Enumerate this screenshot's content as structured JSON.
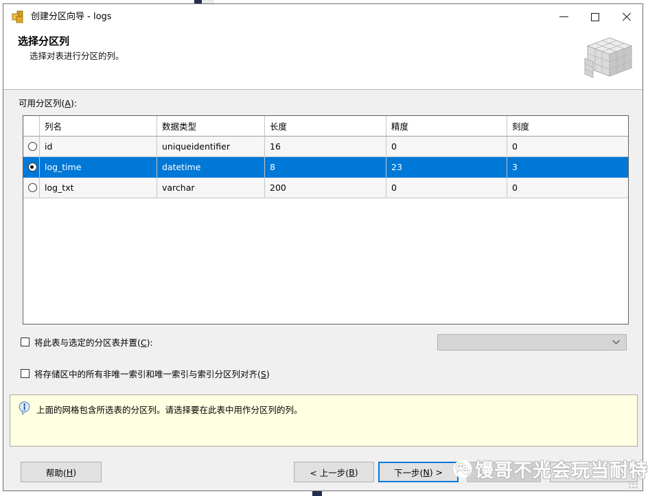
{
  "window": {
    "title": "创建分区向导 - logs",
    "controls": {
      "minimize": "—",
      "maximize": "□",
      "close": "×"
    }
  },
  "header": {
    "title": "选择分区列",
    "subtitle": "选择对表进行分区的列。"
  },
  "grid": {
    "label": {
      "pre": "可用分区列(",
      "key": "A",
      "post": "):"
    },
    "columns": [
      "列名",
      "数据类型",
      "长度",
      "精度",
      "刻度"
    ],
    "rows": [
      {
        "selected": false,
        "cells": [
          "id",
          "uniqueidentifier",
          "16",
          "0",
          "0"
        ]
      },
      {
        "selected": true,
        "cells": [
          "log_time",
          "datetime",
          "8",
          "23",
          "3"
        ]
      },
      {
        "selected": false,
        "cells": [
          "log_txt",
          "varchar",
          "200",
          "0",
          "0"
        ]
      }
    ]
  },
  "options": {
    "collocate": {
      "pre": "将此表与选定的分区表并置(",
      "key": "C",
      "post": "):",
      "checked": false
    },
    "align": {
      "pre": "将存储区中的所有非唯一索引和唯一索引与索引分区列对齐(",
      "key": "S",
      "post": ")",
      "checked": false
    },
    "dropdown_value": ""
  },
  "info": {
    "text": "上面的网格包含所选表的分区列。请选择要在此表中用作分区列的列。"
  },
  "buttons": {
    "help": {
      "pre": "帮助(",
      "key": "H",
      "post": ")"
    },
    "back": {
      "pre": "< 上一步(",
      "key": "B",
      "post": ")"
    },
    "next": {
      "pre": "下一步(",
      "key": "N",
      "post": ") >"
    }
  },
  "watermark": {
    "text": "馒哥不光会玩当耐特"
  },
  "icons": {
    "app": "gold-cubes",
    "header_graphic": "partitioned-cube",
    "dropdown": "chevron-down",
    "info": "info-balloon",
    "watermark": "wechat-bubbles"
  },
  "colors": {
    "selection": "#0078d7",
    "focus_border": "#0078d7",
    "info_bg": "#ffffe1",
    "body_bg": "#f0f0f0"
  }
}
